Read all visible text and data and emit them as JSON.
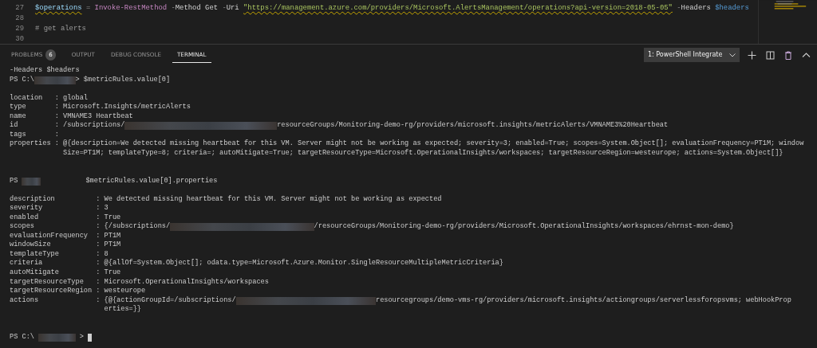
{
  "editor": {
    "lines": [
      {
        "number": "27",
        "tokens": [
          {
            "kind": "variable",
            "text": "$operations",
            "squiggle": true
          },
          {
            "kind": "operator",
            "text": " = "
          },
          {
            "kind": "command",
            "text": "Invoke-RestMethod"
          },
          {
            "kind": "operator",
            "text": " -"
          },
          {
            "kind": "plain",
            "text": "Method Get "
          },
          {
            "kind": "operator",
            "text": "-"
          },
          {
            "kind": "plain",
            "text": "Uri "
          },
          {
            "kind": "string",
            "text": "\"https://management.azure.com/providers/Microsoft.AlertsManagement/operations?api-version=2018-05-05\"",
            "squiggle": true
          },
          {
            "kind": "operator",
            "text": " -"
          },
          {
            "kind": "plain",
            "text": "Headers "
          },
          {
            "kind": "param-var",
            "text": "$headers"
          }
        ]
      },
      {
        "number": "28"
      },
      {
        "number": "29",
        "tokens": [
          {
            "kind": "comment",
            "text": "# get alerts"
          }
        ]
      },
      {
        "number": "30"
      }
    ]
  },
  "panel": {
    "tabs": [
      {
        "label": "PROBLEMS",
        "badge": "6",
        "selected": false
      },
      {
        "label": "OUTPUT",
        "selected": false
      },
      {
        "label": "DEBUG CONSOLE",
        "selected": false
      },
      {
        "label": "TERMINAL",
        "selected": true
      }
    ],
    "terminal_select": "1: PowerShell Integrate"
  },
  "terminal": {
    "blocks": [
      {
        "kind": "line",
        "parts": [
          {
            "kind": "text",
            "text": "-Headers $headers"
          }
        ]
      },
      {
        "kind": "line",
        "parts": [
          {
            "kind": "text",
            "text": "PS C:\\"
          },
          {
            "kind": "redacted"
          },
          {
            "kind": "text",
            "text": "> $metricRules.value[0]"
          }
        ]
      },
      {
        "kind": "blank"
      },
      {
        "kind": "props",
        "rows": [
          {
            "key": "location",
            "sep": ":",
            "lines": [
              [
                {
                  "kind": "text",
                  "text": "global"
                }
              ]
            ]
          },
          {
            "key": "type",
            "sep": ":",
            "lines": [
              [
                {
                  "kind": "text",
                  "text": "Microsoft.Insights/metricAlerts"
                }
              ]
            ]
          },
          {
            "key": "name",
            "sep": ":",
            "lines": [
              [
                {
                  "kind": "text",
                  "text": "VMNAME3 Heartbeat"
                }
              ]
            ]
          },
          {
            "key": "id",
            "sep": ":",
            "lines": [
              [
                {
                  "kind": "text",
                  "text": "/subscriptions/"
                },
                {
                  "kind": "redacted"
                },
                {
                  "kind": "text",
                  "text": "resourceGroups/Monitoring-demo-rg/providers/microsoft.insights/metricAlerts/VMNAME3%20Heartbeat"
                }
              ]
            ]
          },
          {
            "key": "tags",
            "sep": ":",
            "lines": []
          },
          {
            "key": "properties",
            "sep": ":",
            "lines": [
              [
                {
                  "kind": "text",
                  "text": "@{description=We detected missing heartbeat for this VM. Server might not be working as expected; severity=3; enabled=True; scopes=System.Object[]; evaluationFrequency=PT1M; window"
                }
              ],
              [
                {
                  "kind": "text",
                  "text": "Size=PT1M; templateType=8; criteria=; autoMitigate=True; targetResourceType=Microsoft.OperationalInsights/workspaces; targetResourceRegion=westeurope; actions=System.Object[]}"
                }
              ]
            ]
          }
        ]
      },
      {
        "kind": "blank"
      },
      {
        "kind": "blank"
      },
      {
        "kind": "line",
        "parts": [
          {
            "kind": "text",
            "text": "PS"
          },
          {
            "kind": "redacted"
          },
          {
            "kind": "text",
            "text": "$metricRules.value[0].properties"
          }
        ]
      },
      {
        "kind": "blank"
      },
      {
        "kind": "props",
        "rows": [
          {
            "key": "description",
            "sep": ":",
            "lines": [
              [
                {
                  "kind": "text",
                  "text": "We detected missing heartbeat for this VM. Server might not be working as expected"
                }
              ]
            ]
          },
          {
            "key": "severity",
            "sep": ":",
            "lines": [
              [
                {
                  "kind": "text",
                  "text": "3"
                }
              ]
            ]
          },
          {
            "key": "enabled",
            "sep": ":",
            "lines": [
              [
                {
                  "kind": "text",
                  "text": "True"
                }
              ]
            ]
          },
          {
            "key": "scopes",
            "sep": ":",
            "lines": [
              [
                {
                  "kind": "text",
                  "text": "{/subscriptions/"
                },
                {
                  "kind": "redacted"
                },
                {
                  "kind": "text",
                  "text": "/resourceGroups/Monitoring-demo-rg/providers/Microsoft.OperationalInsights/workspaces/ehrnst-mon-demo}"
                }
              ]
            ]
          },
          {
            "key": "evaluationFrequency",
            "sep": ":",
            "lines": [
              [
                {
                  "kind": "text",
                  "text": "PT1M"
                }
              ]
            ]
          },
          {
            "key": "windowSize",
            "sep": ":",
            "lines": [
              [
                {
                  "kind": "text",
                  "text": "PT1M"
                }
              ]
            ]
          },
          {
            "key": "templateType",
            "sep": ":",
            "lines": [
              [
                {
                  "kind": "text",
                  "text": "8"
                }
              ]
            ]
          },
          {
            "key": "criteria",
            "sep": ":",
            "lines": [
              [
                {
                  "kind": "text",
                  "text": "@{allOf=System.Object[]; odata.type=Microsoft.Azure.Monitor.SingleResourceMultipleMetricCriteria}"
                }
              ]
            ]
          },
          {
            "key": "autoMitigate",
            "sep": ":",
            "lines": [
              [
                {
                  "kind": "text",
                  "text": "True"
                }
              ]
            ]
          },
          {
            "key": "targetResourceType",
            "sep": ":",
            "lines": [
              [
                {
                  "kind": "text",
                  "text": "Microsoft.OperationalInsights/workspaces"
                }
              ]
            ]
          },
          {
            "key": "targetResourceRegion",
            "sep": ":",
            "lines": [
              [
                {
                  "kind": "text",
                  "text": "westeurope"
                }
              ]
            ]
          },
          {
            "key": "actions",
            "sep": ":",
            "lines": [
              [
                {
                  "kind": "text",
                  "text": "{@{actionGroupId=/subscriptions/"
                },
                {
                  "kind": "redacted"
                },
                {
                  "kind": "text",
                  "text": "resourcegroups/demo-vms-rg/providers/microsoft.insights/actiongroups/serverlessforopsvms; webHookProp"
                }
              ],
              [
                {
                  "kind": "text",
                  "text": "erties=}}"
                }
              ]
            ]
          }
        ]
      },
      {
        "kind": "blank"
      },
      {
        "kind": "blank"
      },
      {
        "kind": "line",
        "parts": [
          {
            "kind": "text",
            "text": "PS C:\\"
          },
          {
            "kind": "redacted"
          },
          {
            "kind": "text",
            "text": ">"
          },
          {
            "kind": "cursor"
          }
        ]
      }
    ]
  }
}
